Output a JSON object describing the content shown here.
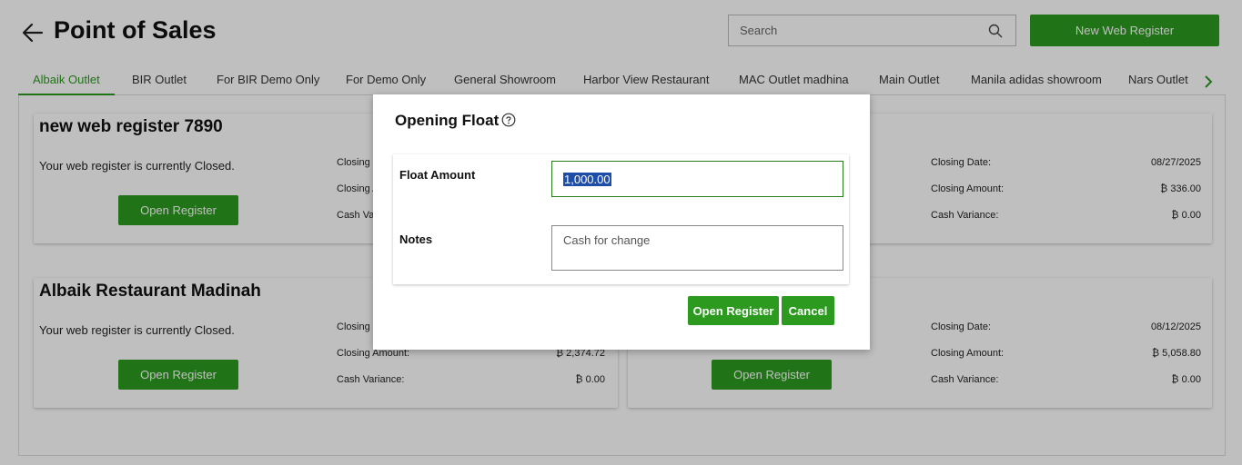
{
  "header": {
    "title": "Point of Sales",
    "search_placeholder": "Search",
    "new_register_label": "New Web Register"
  },
  "tabs": [
    {
      "label": "Albaik Outlet",
      "active": true
    },
    {
      "label": "BIR Outlet"
    },
    {
      "label": "For BIR Demo Only"
    },
    {
      "label": "For Demo Only"
    },
    {
      "label": "General Showroom"
    },
    {
      "label": "Harbor View Restaurant"
    },
    {
      "label": "MAC Outlet madhina"
    },
    {
      "label": "Main Outlet"
    },
    {
      "label": "Manila adidas showroom"
    },
    {
      "label": "Nars Outlet"
    }
  ],
  "cards": [
    {
      "title": "new web register 7890",
      "status": "Your web register is currently Closed.",
      "button_label": "Open Register",
      "closing_date_label": "Closing D",
      "closing_amount_label": "Closing A",
      "cash_variance_label": "Cash Varia"
    },
    {
      "closing_date_label": "Closing Date:",
      "closing_date_value": "08/27/2025",
      "closing_amount_label": "Closing Amount:",
      "closing_amount_value": "₿ 336.00",
      "cash_variance_label": "Cash Variance:",
      "cash_variance_value": "₿ 0.00"
    },
    {
      "title": "Albaik Restaurant Madinah",
      "status": "Your web register is currently Closed.",
      "button_label": "Open Register",
      "closing_date_label": "Closing D",
      "closing_amount_label": "Closing Amount:",
      "closing_amount_value": "₿ 2,374.72",
      "cash_variance_label": "Cash Variance:",
      "cash_variance_value": "₿ 0.00"
    },
    {
      "button_label": "Open Register",
      "closing_date_label": "Closing Date:",
      "closing_date_value": "08/12/2025",
      "closing_amount_label": "Closing Amount:",
      "closing_amount_value": "₿ 5,058.80",
      "cash_variance_label": "Cash Variance:",
      "cash_variance_value": "₿ 0.00"
    }
  ],
  "modal": {
    "title": "Opening Float",
    "float_amount_label": "Float Amount",
    "float_amount_value": "1,000.00",
    "notes_label": "Notes",
    "notes_placeholder": "Cash for change",
    "open_label": "Open Register",
    "cancel_label": "Cancel"
  },
  "colors": {
    "accent": "#2c9a1f",
    "selection": "#1f4ea8"
  }
}
